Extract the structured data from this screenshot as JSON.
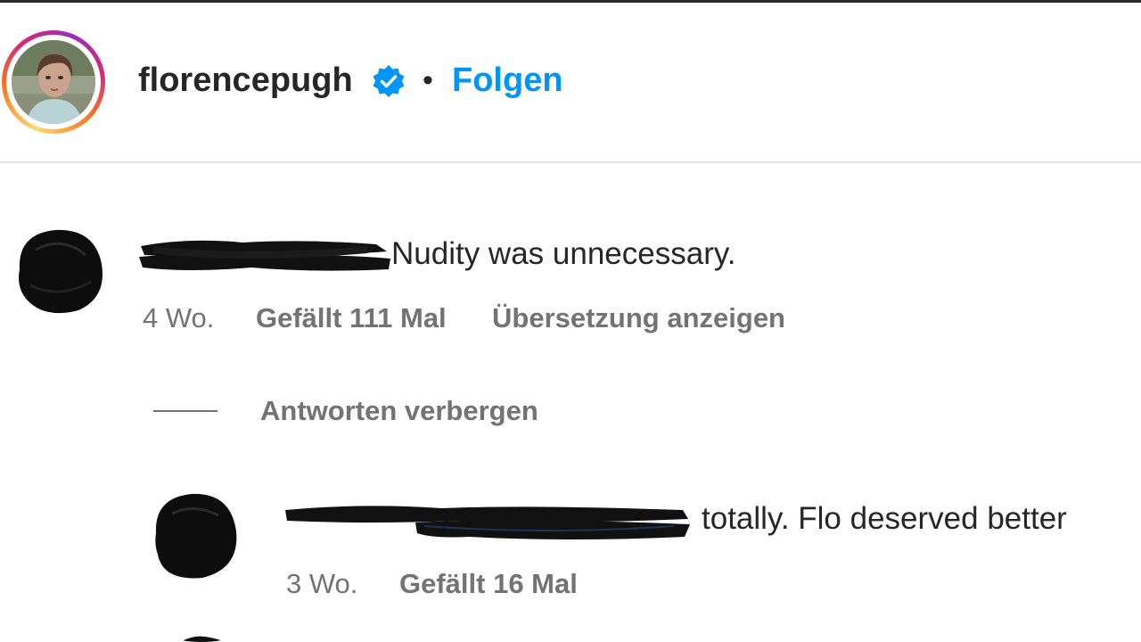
{
  "header": {
    "username": "florencepugh",
    "separator": "•",
    "follow_label": "Folgen"
  },
  "colors": {
    "accent": "#0095f6",
    "text": "#262626",
    "secondary": "#737373",
    "divider": "#e4e4e4"
  },
  "icons": {
    "verified": "verified-badge-icon"
  },
  "comments": [
    {
      "text": "Nudity was unnecessary.",
      "age": "4 Wo.",
      "likes": "Gefällt 111 Mal",
      "translate": "Übersetzung anzeigen",
      "replies_toggle": "Antworten verbergen",
      "replies": [
        {
          "text": "totally. Flo deserved better",
          "age": "3 Wo.",
          "likes": "Gefällt 16 Mal"
        }
      ]
    }
  ]
}
